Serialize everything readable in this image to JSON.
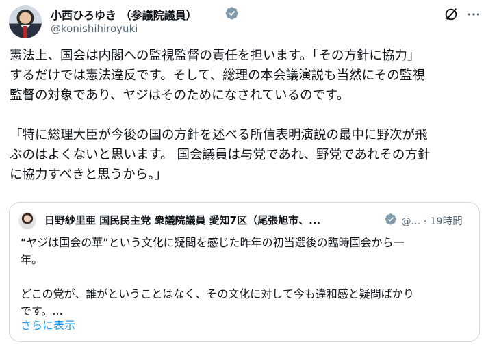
{
  "author": {
    "name": "小西ひろゆき （参議院議員）",
    "handle": "@konishihiroyuki"
  },
  "post": {
    "lines": [
      "憲法上、国会は内閣への監視監督の責任を担います。「その方針に協力」",
      "するだけでは憲法違反です。そして、総理の本会議演説も当然にその監視",
      "監督の対象であり、ヤジはそのためになされているのです。",
      "「特に総理大臣が今後の国の方針を述べる所信表明演説の最中に野次が飛",
      "ぶのはよくないと思います。 国会議員は与党であれ、野党であれその方針",
      "に協力すべきと思うから。」"
    ]
  },
  "quoted": {
    "name": "日野紗里亜 国民民主党 衆議院議員 愛知7区（尾張旭市、...",
    "handle_time": "@... · 19時間",
    "lines": [
      "“ヤジは国会の華”という文化に疑問を感じた昨年の初当選後の臨時国会から一",
      "年。",
      "どこの党が、誰がということはなく、その文化に対して今も違和感と疑問ばかり",
      "です。..."
    ],
    "show_more": "さらに表示"
  },
  "colors": {
    "accent": "#1d9bf0",
    "secondary_text": "#536471",
    "verified_badge": "#829aab"
  },
  "icons": [
    "verified-badge-icon",
    "grok-icon",
    "more-icon"
  ]
}
